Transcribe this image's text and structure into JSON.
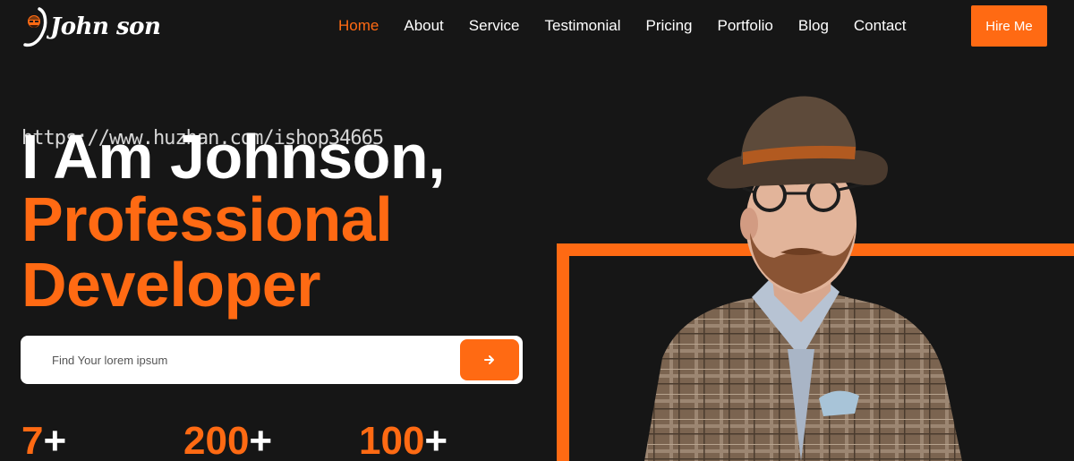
{
  "brand": {
    "name": "John son"
  },
  "nav": {
    "items": [
      {
        "label": "Home",
        "active": true
      },
      {
        "label": "About",
        "active": false
      },
      {
        "label": "Service",
        "active": false
      },
      {
        "label": "Testimonial",
        "active": false
      },
      {
        "label": "Pricing",
        "active": false
      },
      {
        "label": "Portfolio",
        "active": false
      },
      {
        "label": "Blog",
        "active": false
      },
      {
        "label": "Contact",
        "active": false
      }
    ],
    "cta_label": "Hire Me"
  },
  "hero": {
    "line1": "I Am Johnson,",
    "line2": "Professional",
    "line3": "Developer",
    "watermark": "https://www.huzhan.com/ishop34665"
  },
  "search": {
    "placeholder": "Find Your lorem ipsum",
    "value": "",
    "button_icon": "arrow-right-icon"
  },
  "stats": [
    {
      "number": "7",
      "suffix": "+"
    },
    {
      "number": "200",
      "suffix": "+"
    },
    {
      "number": "100",
      "suffix": "+"
    }
  ],
  "colors": {
    "accent": "#ff6a13",
    "background": "#161616",
    "text": "#ffffff"
  }
}
